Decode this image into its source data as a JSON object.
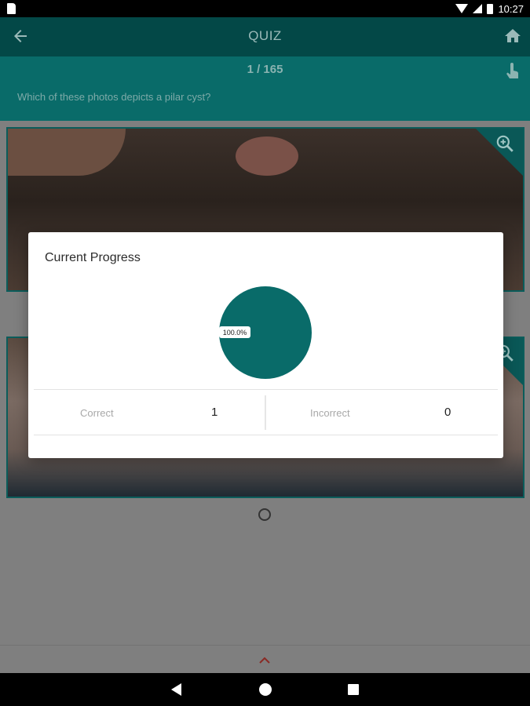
{
  "status_bar": {
    "time": "10:27"
  },
  "app_bar": {
    "title": "QUIZ"
  },
  "question_header": {
    "counter": "1 / 165",
    "question": "Which of these photos depicts a pilar cyst?"
  },
  "dialog": {
    "title": "Current Progress",
    "chart_data": {
      "type": "pie",
      "slices": [
        {
          "name": "Correct",
          "value": 1,
          "label": "100.0%",
          "color": "#096b69"
        },
        {
          "name": "Incorrect",
          "value": 0,
          "color": "#cccccc"
        }
      ]
    },
    "stats": [
      {
        "label": "Correct",
        "value": "1"
      },
      {
        "label": "Incorrect",
        "value": "0"
      }
    ]
  },
  "colors": {
    "primary_dark": "#034847",
    "primary": "#096b69",
    "accent_chevron": "#d32f2f"
  },
  "icons": [
    "back-arrow-icon",
    "home-icon",
    "touch-icon",
    "zoom-in-icon",
    "chevron-up-icon"
  ]
}
